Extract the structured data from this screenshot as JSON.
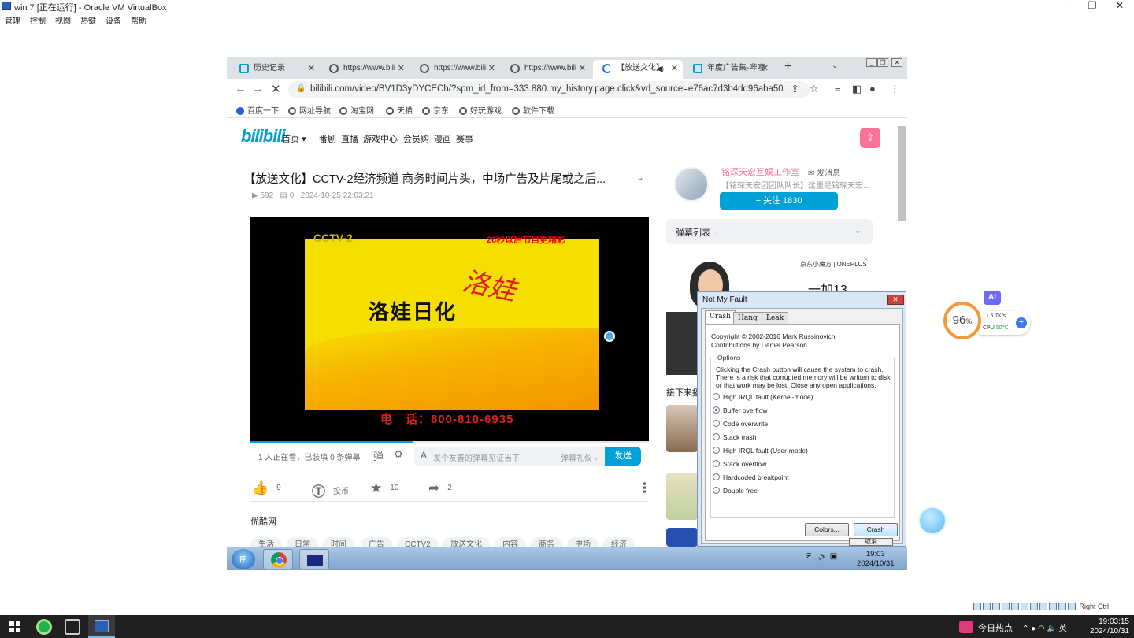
{
  "vbox": {
    "title": "win 7 [正在运行] - Oracle VM VirtualBox",
    "menu": [
      "管理",
      "控制",
      "视图",
      "热键",
      "设备",
      "帮助"
    ],
    "status_host_key": "Right Ctrl"
  },
  "browser": {
    "tabs": [
      {
        "label": "历史记录",
        "icon": "bilibili-tv-icon"
      },
      {
        "label": "https://www.bili",
        "icon": "globe-icon"
      },
      {
        "label": "https://www.bili",
        "icon": "globe-icon"
      },
      {
        "label": "https://www.bili",
        "icon": "globe-icon"
      },
      {
        "label": "【放送文化】",
        "icon": "loading-icon",
        "active": true
      },
      {
        "label": "年度广告集-哔哩",
        "icon": "bilibili-tv-icon"
      }
    ],
    "url": "bilibili.com/video/BV1D3yDYCECh/?spm_id_from=333.880.my_history.page.click&vd_source=e76ac7d3b4dd96aba509...",
    "bookmarks": [
      "百度一下",
      "网址导航",
      "淘宝网",
      "天猫",
      "京东",
      "好玩游戏",
      "软件下载"
    ]
  },
  "site": {
    "logo": "bilibili",
    "nav": [
      "首页",
      "番剧",
      "直播",
      "游戏中心",
      "会员购",
      "漫画",
      "赛事"
    ],
    "video_title": "【放送文化】CCTV-2经济频道 商务时间片头，中场广告及片尾或之后...",
    "views": "592",
    "danmaku_count": "0",
    "date": "2024-10-25 22:03:21",
    "ad": {
      "cctv": "CCTV-2",
      "top_text": "26秒以后节目更精彩",
      "brand": "洛娃日化",
      "script": "洛娃",
      "phone": "电　话：800-810-6935"
    },
    "progress": 0.41,
    "watching": "1 人正在看，已装填 0 条弹幕",
    "danmaku_placeholder": "发个友善的弹幕见证当下",
    "danmaku_etiquette": "弹幕礼仪",
    "send": "发送",
    "likes": "9",
    "coin": "投币",
    "favorites": "10",
    "shares": "2",
    "source": "优酷网",
    "tags": [
      "生活",
      "日常",
      "时间",
      "广告",
      "CCTV2",
      "放送文化",
      "内容",
      "商务",
      "中场",
      "经济"
    ],
    "uploader": {
      "name": "铭琛天宏互娱工作室",
      "message": "发消息",
      "desc": "【铭琛天宏团团队队长】这里是铭琛天宏...",
      "follow": "+ 关注 1830"
    },
    "danmaku_list": "弹幕列表",
    "side_ad": {
      "brands": "京东小魔方 | ONEPLUS",
      "model": "一加13"
    },
    "next_up": "接下来播"
  },
  "dialog": {
    "title": "Not My Fault",
    "tabs": [
      "Crash",
      "Hang",
      "Leak"
    ],
    "copyright": "Copyright © 2002-2016 Mark Russinovich",
    "contrib": "Contributions by Daniel Pearson",
    "options_label": "Options",
    "warning": "Clicking the Crash button will cause the system to crash. There is a risk that corrupted memory will be written to disk or that work may be lost. Close any open applications.",
    "options": [
      "High IRQL fault (Kernel-mode)",
      "Buffer overflow",
      "Code overwrite",
      "Stack trash",
      "High IRQL fault (User-mode)",
      "Stack overflow",
      "Hardcoded breakpoint",
      "Double free"
    ],
    "selected": "Buffer overflow",
    "colors": "Colors...",
    "crash": "Crash",
    "cancel": "取消"
  },
  "win7": {
    "time": "19:03",
    "date": "2024/10/31"
  },
  "widgets": {
    "ai": "AI",
    "cpu_load": "96",
    "net": "5.7K/s",
    "cpu_label": "CPU",
    "cpu_temp": "50℃"
  },
  "host": {
    "news": "今日热点",
    "ime": "英",
    "time": "19:03:15",
    "date": "2024/10/31"
  }
}
